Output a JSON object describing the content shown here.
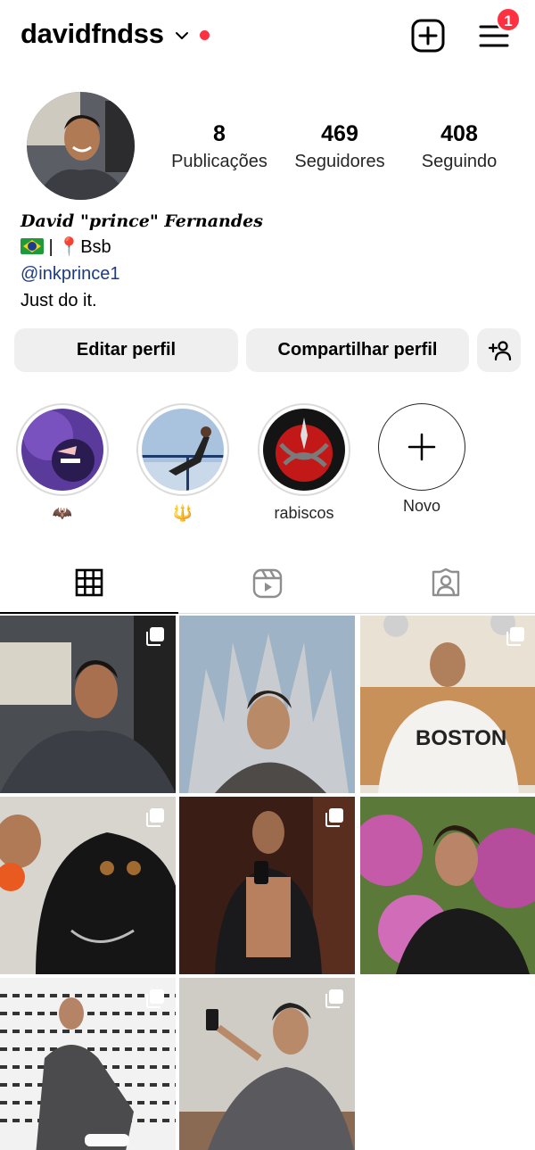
{
  "header": {
    "username": "davidfndss",
    "notification_count": "1",
    "accent_color": "#ff3040"
  },
  "stats": [
    {
      "value": "8",
      "label": "Publicações"
    },
    {
      "value": "469",
      "label": "Seguidores"
    },
    {
      "value": "408",
      "label": "Seguindo"
    }
  ],
  "bio": {
    "name": "David \"prince\" Fernandes",
    "location_line": " | 📍Bsb",
    "link": "@inkprince1",
    "tagline": "Just do it."
  },
  "buttons": {
    "edit_profile": "Editar perfil",
    "share_profile": "Compartilhar perfil"
  },
  "highlights": [
    {
      "caption": "🦇"
    },
    {
      "caption": "🔱"
    },
    {
      "caption": "rabiscos"
    },
    {
      "caption": "Novo"
    }
  ],
  "icons": {
    "header": [
      "new-post-icon",
      "menu-icon"
    ],
    "tabs": [
      "grid-icon",
      "reels-icon",
      "tagged-icon"
    ]
  }
}
